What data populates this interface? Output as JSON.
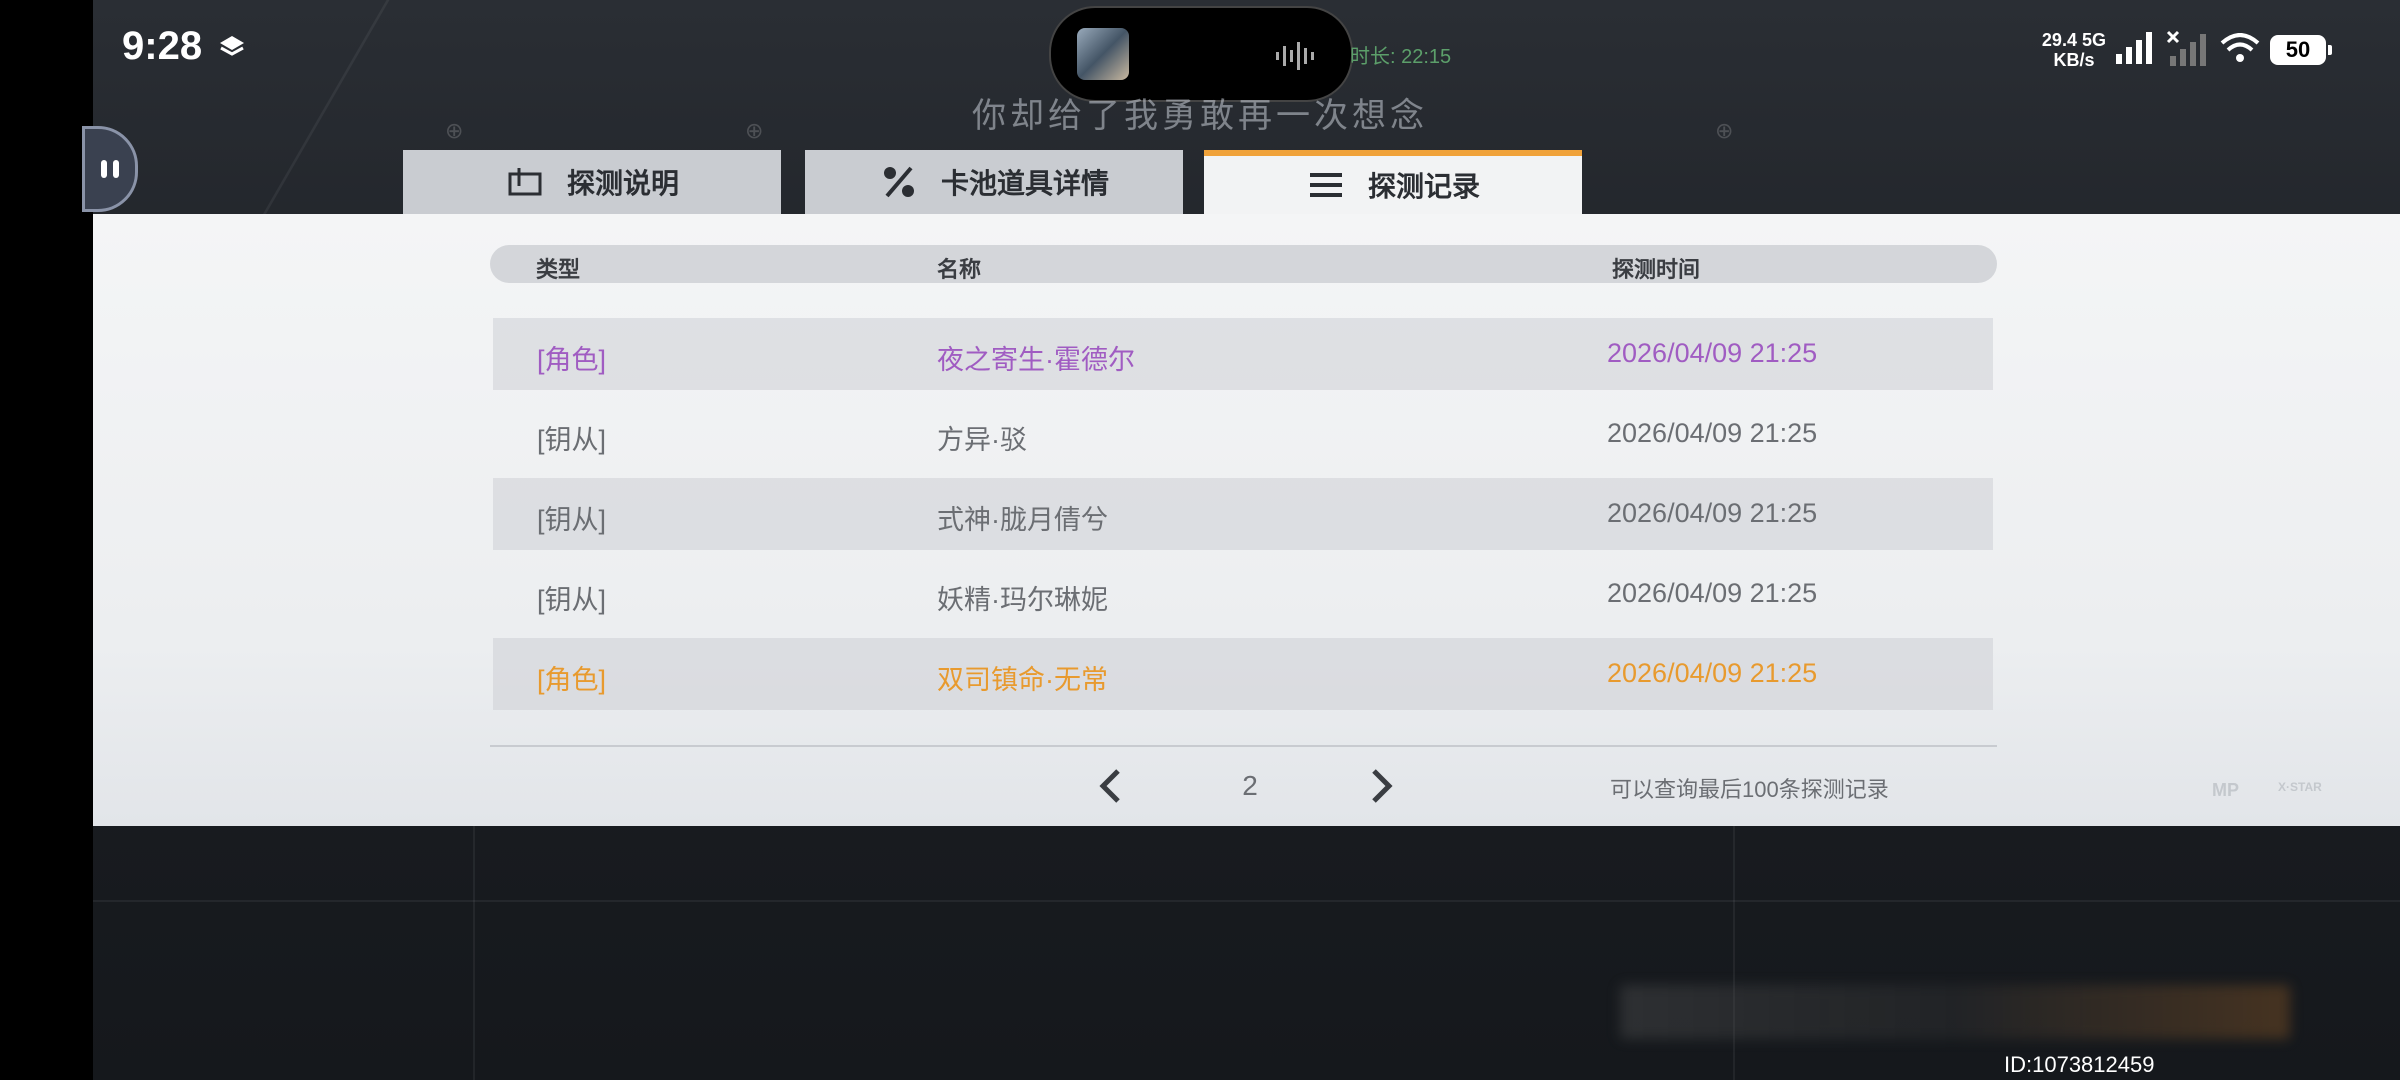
{
  "status_bar": {
    "time": "9:28",
    "net_speed_value": "29.4",
    "net_speed_unit": "KB/s",
    "net_type": "5G",
    "battery": "50"
  },
  "island": {
    "record_time": "时长: 22:15"
  },
  "lyric": "你却给了我勇敢再一次想念",
  "tabs": [
    {
      "label": "探测说明",
      "icon": "info-board-icon",
      "active": false
    },
    {
      "label": "卡池道具详情",
      "icon": "percent-icon",
      "active": false
    },
    {
      "label": "探测记录",
      "icon": "list-icon",
      "active": true
    }
  ],
  "table": {
    "headers": {
      "type": "类型",
      "name": "名称",
      "time": "探测时间"
    },
    "rows": [
      {
        "type": "[角色]",
        "name": "夜之寄生·霍德尔",
        "time": "2026/04/09 21:25",
        "color": "#a05cc2"
      },
      {
        "type": "[钥从]",
        "name": "方异·驳",
        "time": "2026/04/09 21:25",
        "color": "#6b6e73"
      },
      {
        "type": "[钥从]",
        "name": "式神·胧月倩兮",
        "time": "2026/04/09 21:25",
        "color": "#6b6e73"
      },
      {
        "type": "[钥从]",
        "name": "妖精·玛尔琳妮",
        "time": "2026/04/09 21:25",
        "color": "#6b6e73"
      },
      {
        "type": "[角色]",
        "name": "双司镇命·无常",
        "time": "2026/04/09 21:25",
        "color": "#e89a2e"
      }
    ]
  },
  "pagination": {
    "page": "2",
    "note": "可以查询最后100条探测记录"
  },
  "footer": {
    "uid": "ID:1073812459",
    "logo_left": "MP",
    "logo_right": "X·STAR"
  },
  "colors": {
    "accent": "#f0a23a",
    "purple": "#a05cc2",
    "orange": "#e89a2e"
  }
}
